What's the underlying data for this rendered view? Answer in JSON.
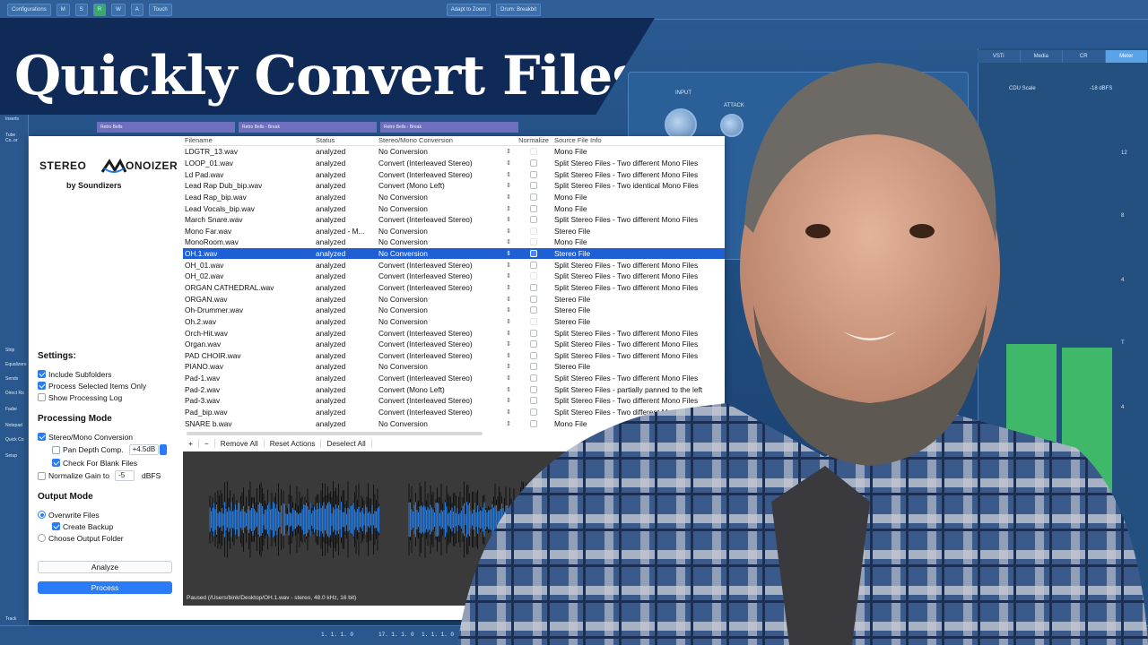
{
  "title": "Quickly Convert Files",
  "daw": {
    "toolbar": [
      "Configurations",
      "M",
      "S",
      "R",
      "W",
      "A",
      "Touch",
      "Adapt to Zoom",
      "Drum: Breakbit"
    ],
    "tabs": [
      "VSTi",
      "Media",
      "CR",
      "Meter"
    ],
    "active_tab": "Meter",
    "left_strip": [
      "Inserts",
      "Tube Co..or",
      "Strip",
      "Equalizers",
      "Sends",
      "Direct Ro",
      "Fader",
      "Notepad",
      "Quick Co",
      "Setup",
      "Track"
    ],
    "clip_labels": [
      "Retro Bells",
      "Retro Bells - Break",
      "Retro Bells - Break"
    ],
    "plugin_labels": [
      "INPUT",
      "ATTACK",
      "CDU Scale",
      "-18 dBFS"
    ],
    "meter_scale": [
      "12",
      "8",
      "4",
      "T",
      "4"
    ],
    "bottom_readouts": [
      "1. 1. 1. 0",
      "17. 1. 1. 0",
      "1. 1. 1. 0"
    ]
  },
  "app": {
    "logo": {
      "main_left": "STEREO",
      "main_right": "ONOIZER",
      "sub": "by Soundizers"
    },
    "columns": [
      "Filename",
      "Status",
      "Stereo/Mono Conversion",
      "Normalize",
      "Source File Info"
    ],
    "rows": [
      {
        "file": "LDGTR_13.wav",
        "status": "analyzed",
        "conv": "No Conversion",
        "arrow": false,
        "norm": false,
        "info": "Mono File"
      },
      {
        "file": "LOOP_01.wav",
        "status": "analyzed",
        "conv": "Convert (Interleaved Stereo)",
        "arrow": true,
        "norm": true,
        "info": "Split Stereo Files - Two different Mono Files"
      },
      {
        "file": "Ld Pad.wav",
        "status": "analyzed",
        "conv": "Convert (Interleaved Stereo)",
        "arrow": true,
        "norm": true,
        "info": "Split Stereo Files - Two different Mono Files"
      },
      {
        "file": "Lead Rap Dub_bip.wav",
        "status": "analyzed",
        "conv": "Convert (Mono Left)",
        "arrow": true,
        "norm": true,
        "info": "Split Stereo Files - Two identical Mono Files"
      },
      {
        "file": "Lead Rap_bip.wav",
        "status": "analyzed",
        "conv": "No Conversion",
        "arrow": false,
        "norm": true,
        "info": "Mono File"
      },
      {
        "file": "Lead Vocals_bip.wav",
        "status": "analyzed",
        "conv": "No Conversion",
        "arrow": false,
        "norm": true,
        "info": "Mono File"
      },
      {
        "file": "March Snare.wav",
        "status": "analyzed",
        "conv": "Convert (Interleaved Stereo)",
        "arrow": true,
        "norm": true,
        "info": "Split Stereo Files - Two different Mono Files"
      },
      {
        "file": "Mono Far.wav",
        "status": "analyzed - M...",
        "conv": "No Conversion",
        "arrow": false,
        "norm": false,
        "info": "Stereo File"
      },
      {
        "file": "MonoRoom.wav",
        "status": "analyzed",
        "conv": "No Conversion",
        "arrow": false,
        "norm": false,
        "info": "Mono File"
      },
      {
        "file": "OH.1.wav",
        "status": "analyzed",
        "conv": "No Conversion",
        "arrow": true,
        "norm": true,
        "info": "Stereo File",
        "selected": true
      },
      {
        "file": "OH_01.wav",
        "status": "analyzed",
        "conv": "Convert (Interleaved Stereo)",
        "arrow": true,
        "norm": true,
        "info": "Split Stereo Files - Two different Mono Files"
      },
      {
        "file": "OH_02.wav",
        "status": "analyzed",
        "conv": "Convert (Interleaved Stereo)",
        "arrow": true,
        "norm": false,
        "info": "Split Stereo Files - Two different Mono Files"
      },
      {
        "file": "ORGAN CATHEDRAL.wav",
        "status": "analyzed",
        "conv": "Convert (Interleaved Stereo)",
        "arrow": true,
        "norm": true,
        "info": "Split Stereo Files - Two different Mono Files"
      },
      {
        "file": "ORGAN.wav",
        "status": "analyzed",
        "conv": "No Conversion",
        "arrow": false,
        "norm": true,
        "info": "Stereo File"
      },
      {
        "file": "Oh-Drummer.wav",
        "status": "analyzed",
        "conv": "No Conversion",
        "arrow": false,
        "norm": true,
        "info": "Stereo File"
      },
      {
        "file": "Oh.2.wav",
        "status": "analyzed",
        "conv": "No Conversion",
        "arrow": false,
        "norm": false,
        "info": "Stereo File"
      },
      {
        "file": "Orch-Hit.wav",
        "status": "analyzed",
        "conv": "Convert (Interleaved Stereo)",
        "arrow": true,
        "norm": true,
        "info": "Split Stereo Files - Two different Mono Files"
      },
      {
        "file": "Organ.wav",
        "status": "analyzed",
        "conv": "Convert (Interleaved Stereo)",
        "arrow": true,
        "norm": true,
        "info": "Split Stereo Files - Two different Mono Files"
      },
      {
        "file": "PAD CHOIR.wav",
        "status": "analyzed",
        "conv": "Convert (Interleaved Stereo)",
        "arrow": true,
        "norm": true,
        "info": "Split Stereo Files - Two different Mono Files"
      },
      {
        "file": "PIANO.wav",
        "status": "analyzed",
        "conv": "No Conversion",
        "arrow": false,
        "norm": true,
        "info": "Stereo File"
      },
      {
        "file": "Pad-1.wav",
        "status": "analyzed",
        "conv": "Convert (Interleaved Stereo)",
        "arrow": true,
        "norm": true,
        "info": "Split Stereo Files - Two different Mono Files"
      },
      {
        "file": "Pad-2.wav",
        "status": "analyzed",
        "conv": "Convert (Mono Left)",
        "arrow": true,
        "norm": true,
        "info": "Split Stereo Files - partially panned to the left"
      },
      {
        "file": "Pad-3.wav",
        "status": "analyzed",
        "conv": "Convert (Interleaved Stereo)",
        "arrow": true,
        "norm": true,
        "info": "Split Stereo Files - Two different Mono Files"
      },
      {
        "file": "Pad_bip.wav",
        "status": "analyzed",
        "conv": "Convert (Interleaved Stereo)",
        "arrow": true,
        "norm": true,
        "info": "Split Stereo Files - Two different Mono Files"
      },
      {
        "file": "SNARE b.wav",
        "status": "analyzed",
        "conv": "No Conversion",
        "arrow": false,
        "norm": true,
        "info": "Mono File"
      }
    ],
    "table_bar": {
      "add": "+",
      "remove": "−",
      "remove_all": "Remove All",
      "reset": "Reset Actions",
      "deselect": "Deselect All"
    },
    "settings": {
      "title": "Settings:",
      "include_subfolders": "Include Subfolders",
      "process_selected": "Process Selected Items Only",
      "show_log": "Show Processing Log"
    },
    "processing_mode": {
      "title": "Processing Mode",
      "stereo_mono": "Stereo/Mono Conversion",
      "pan_depth": "Pan Depth Comp.",
      "pan_value": "+4.5dB",
      "check_blank": "Check For Blank Files",
      "normalize": "Normalize Gain to",
      "normalize_value": "-5",
      "normalize_unit": "dBFS"
    },
    "output_mode": {
      "title": "Output Mode",
      "overwrite": "Overwrite Files",
      "create_backup": "Create Backup",
      "choose_folder": "Choose Output Folder"
    },
    "buttons": {
      "analyze": "Analyze",
      "process": "Process"
    },
    "wave_status": "Paused (/Users/bink/Desktop/OH.1.wav - stereo, 48.0 kHz, 16 bit)",
    "wave_color": "#1e7be6"
  }
}
